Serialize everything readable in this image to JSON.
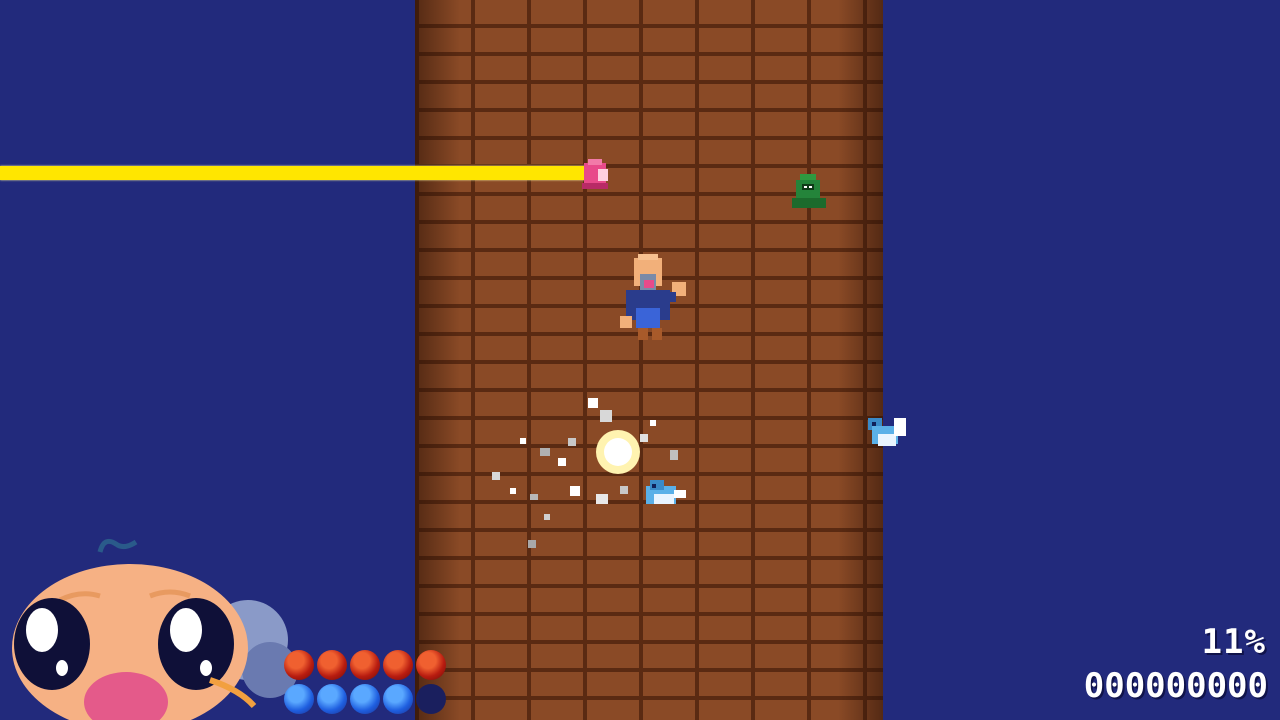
{
  "hud": {
    "progress_percent": "11%",
    "score": "000000000"
  },
  "player": {
    "health_orbs": 5,
    "health_max": 5,
    "magic_orbs": 4,
    "magic_max": 5
  },
  "colors": {
    "sky": "#222a7c",
    "brick": "#8a4a26",
    "mortar": "#5a2a12",
    "beam": "#ffe600",
    "health": "#d83018",
    "magic": "#2f6ff0"
  },
  "icons": {
    "enemy_pink": "pink-slime-icon",
    "enemy_green": "green-hooded-icon",
    "bird": "blue-bird-icon",
    "explosion": "explosion-icon",
    "portrait": "old-man-portrait"
  }
}
